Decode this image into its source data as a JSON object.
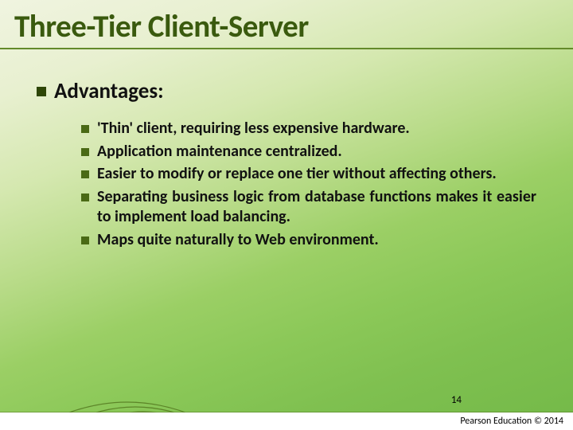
{
  "title": "Three-Tier Client-Server",
  "heading": "Advantages:",
  "items": [
    "'Thin' client, requiring less expensive hardware.",
    "Application maintenance centralized.",
    "Easier to modify or replace one tier without affecting others.",
    "Separating business logic from database functions makes it easier to implement load balancing.",
    "Maps quite naturally to Web environment."
  ],
  "page_number": "14",
  "copyright": "Pearson Education © 2014"
}
